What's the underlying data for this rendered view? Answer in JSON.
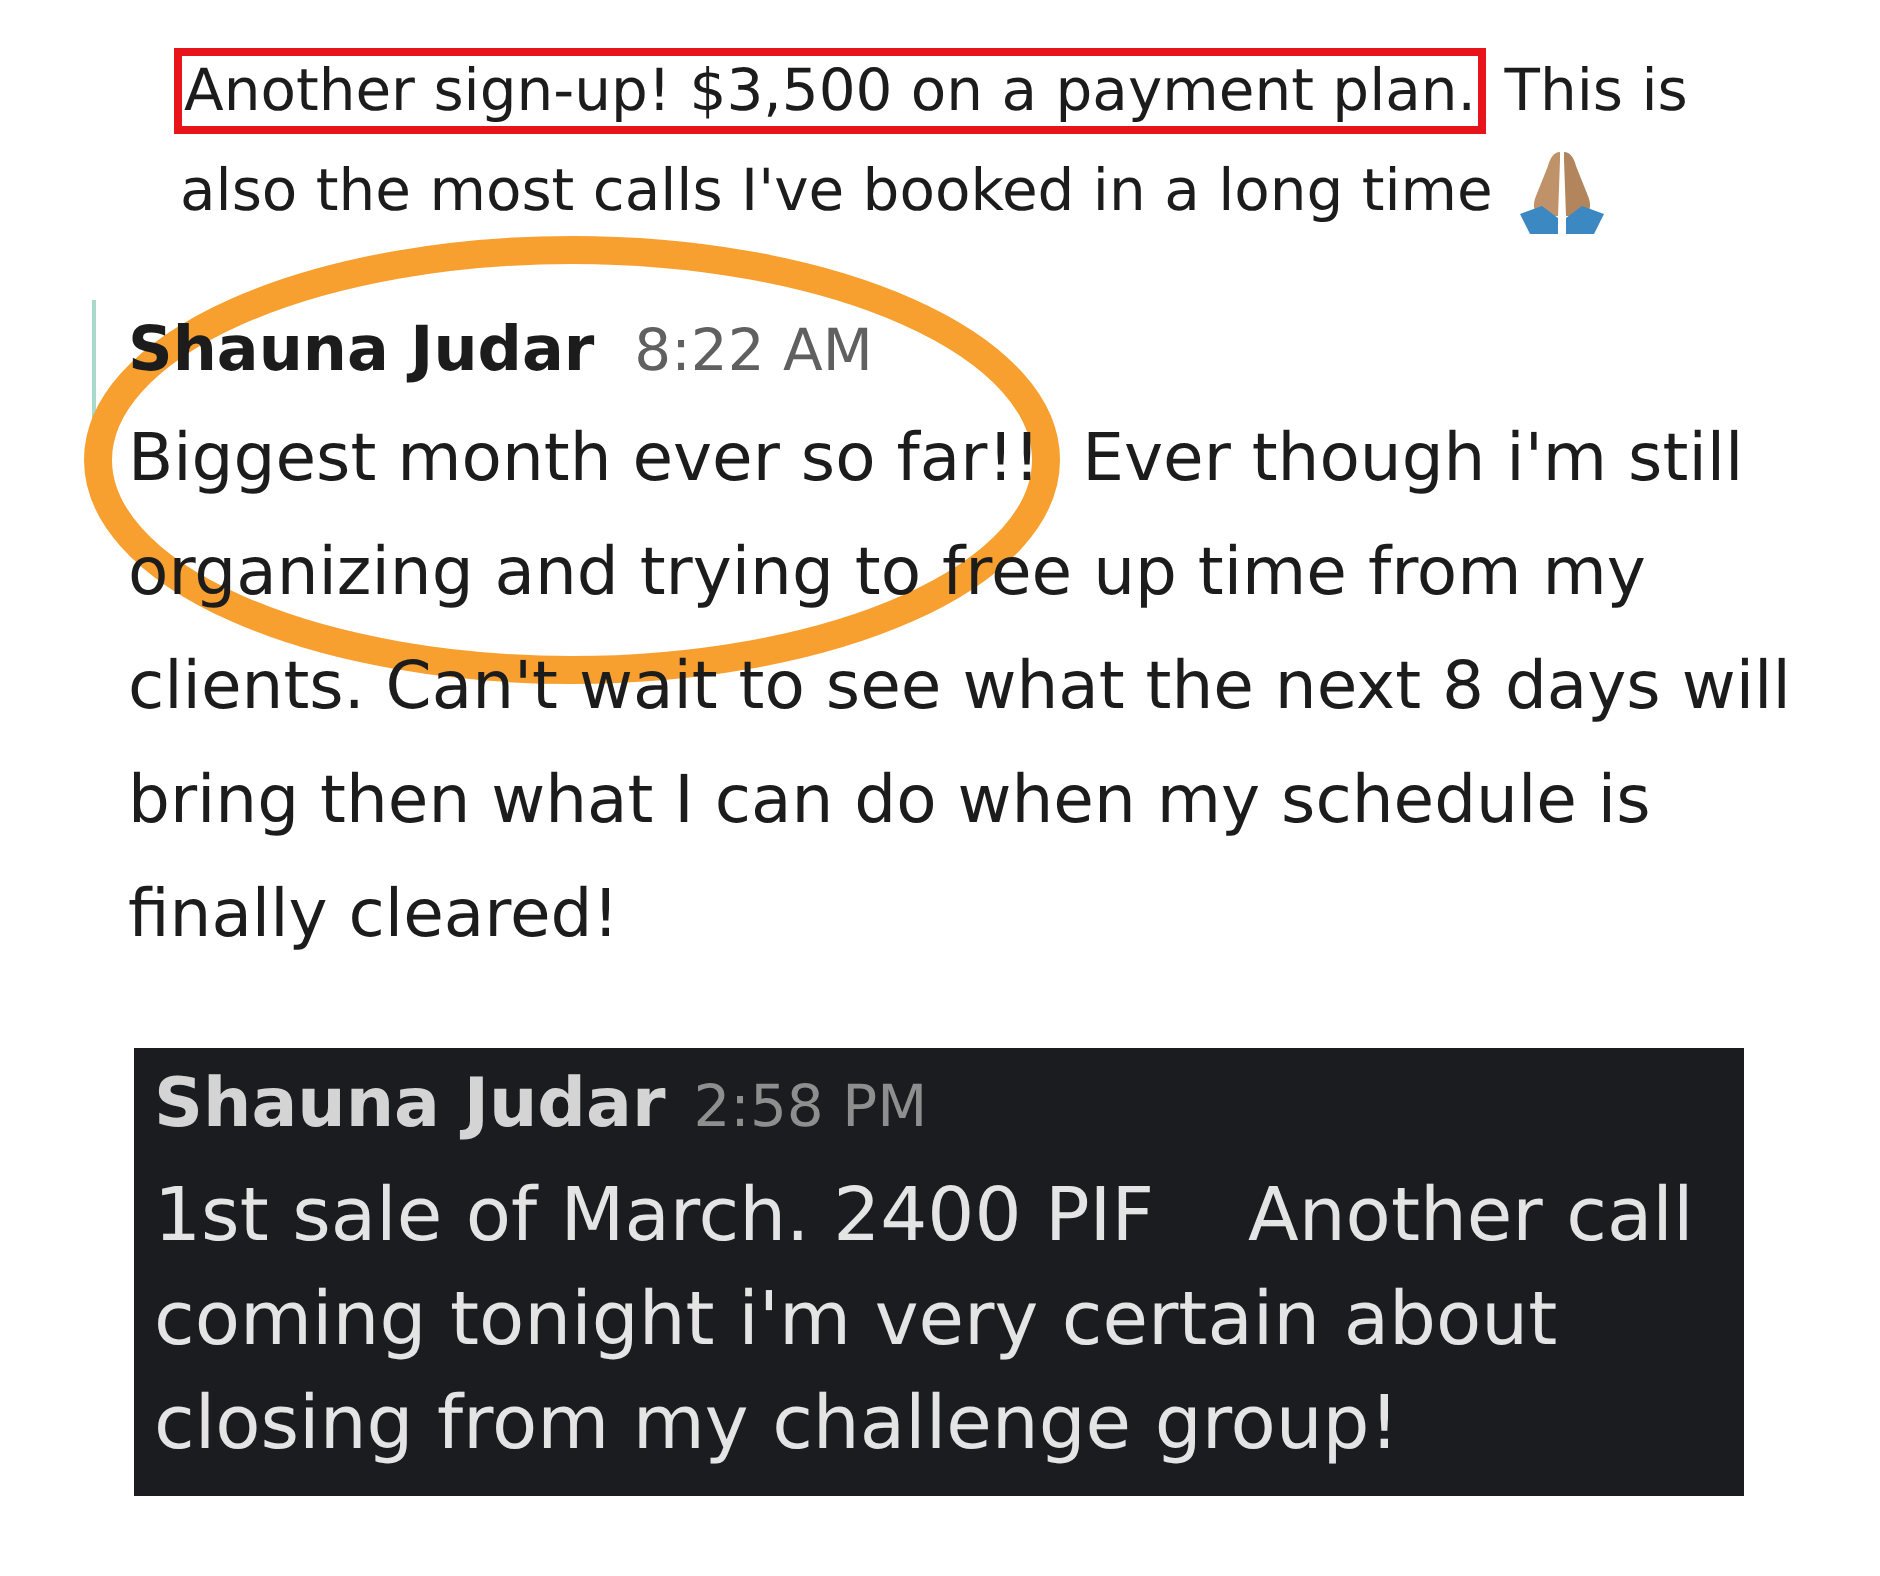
{
  "messages": [
    {
      "kind": "continuation",
      "circled": false,
      "highlight": "Another sign-up! $3,500 on a payment plan.",
      "text": "This is also the most calls I've booked in a long time"
    },
    {
      "kind": "plain",
      "circled": true,
      "author": "Shauna Judar",
      "time": "8:22 AM",
      "text": "Biggest month ever so far!!  Ever though i'm still organizing and trying to free up time from my clients. Can't wait to see what the next 8 days will bring then what I can do when my schedule is finally cleared!"
    },
    {
      "kind": "dark",
      "circled": false,
      "author": "Shauna Judar",
      "time": "2:58 PM",
      "text": "1st sale of March. 2400 PIF    Another call coming tonight i'm very certain about closing from my challenge group!"
    }
  ]
}
